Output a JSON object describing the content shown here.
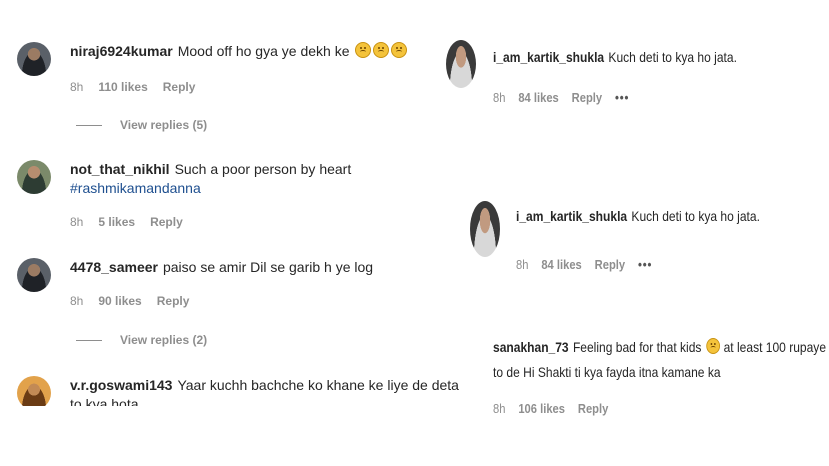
{
  "left_comments": [
    {
      "username": "niraj6924kumar",
      "text": "Mood off ho gya ye dekh ke",
      "emojis": [
        "sad-face",
        "sad-face",
        "sad-face"
      ],
      "time": "8h",
      "likes": "110 likes",
      "reply": "Reply",
      "view_replies": "View replies (5)"
    },
    {
      "username": "not_that_nikhil",
      "text": "Such a poor person by heart",
      "hashtag": "#rashmikamandanna",
      "time": "8h",
      "likes": "5 likes",
      "reply": "Reply"
    },
    {
      "username": "4478_sameer",
      "text": "paiso se amir Dil se garib h ye log",
      "time": "8h",
      "likes": "90 likes",
      "reply": "Reply",
      "view_replies": "View replies (2)"
    },
    {
      "username": "v.r.goswami143",
      "text": "Yaar kuchh bachche ko khane ke liye de deta",
      "text_line2": "to kya hota"
    }
  ],
  "right_comments": [
    {
      "username": "i_am_kartik_shukla",
      "text": "Kuch deti to kya ho jata.",
      "time": "8h",
      "likes": "84 likes",
      "reply": "Reply",
      "more": "•••"
    },
    {
      "username": "i_am_kartik_shukla",
      "text": "Kuch deti to kya ho jata.",
      "time": "8h",
      "likes": "84 likes",
      "reply": "Reply",
      "more": "•••"
    },
    {
      "username": "sanakhan_73",
      "text": "Feeling bad for that kids",
      "emoji": "sad-face",
      "text_after": "at least 100 rupaye",
      "text_line2": "to de Hi Shakti ti kya fayda itna kamane ka",
      "time": "8h",
      "likes": "106 likes",
      "reply": "Reply"
    }
  ],
  "colors": {
    "hashtag": "#1e4f8f",
    "meta": "#8e8e8e",
    "text": "#262626"
  }
}
